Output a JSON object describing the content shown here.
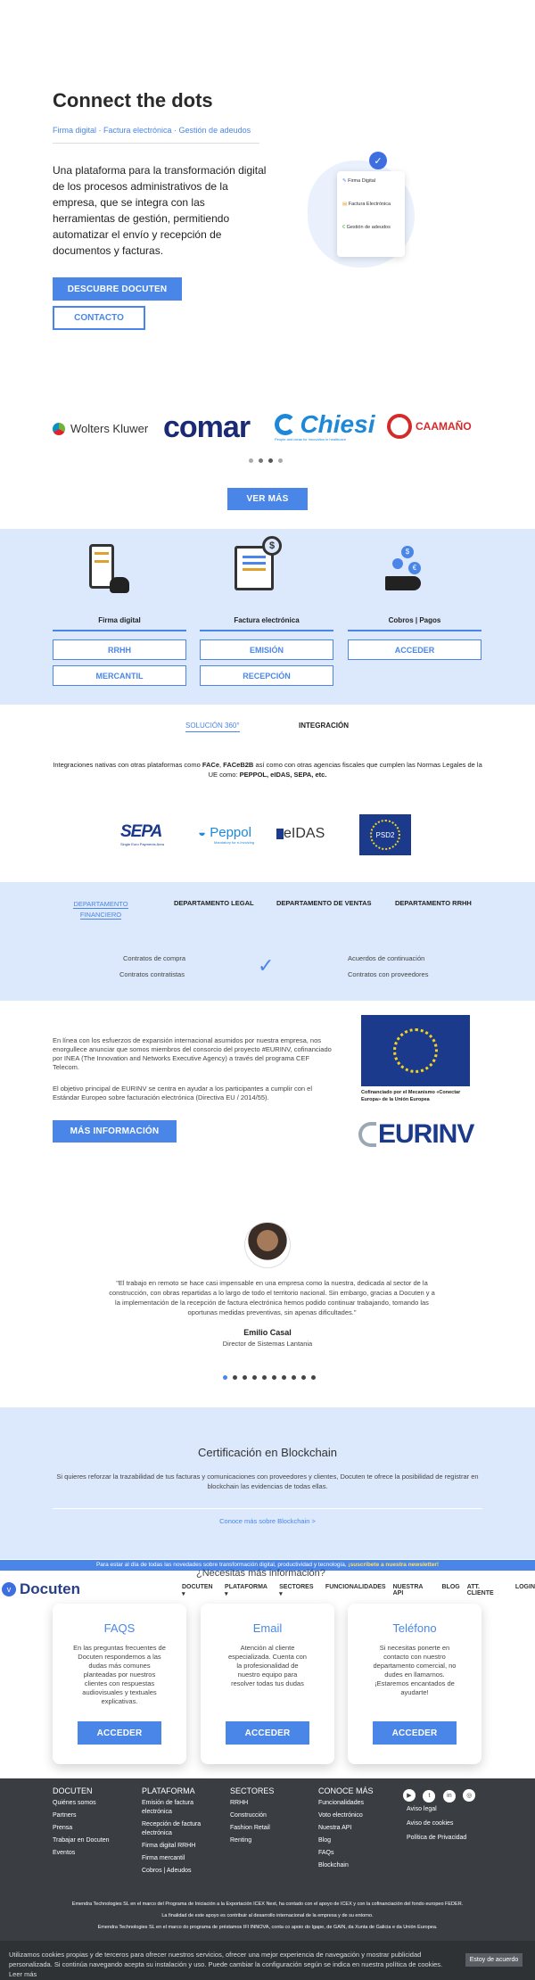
{
  "hero": {
    "title": "Connect the dots",
    "subtitle": "Firma digital · Factura electrónica · Gestión de adeudos",
    "description": "Una plataforma para la transformación digital de los procesos administrativos de la empresa, que se integra con las herramientas de gestión, permitiendo automatizar el envío y recepción de documentos y facturas.",
    "cta_primary": "DESCUBRE DOCUTEN",
    "cta_secondary": "CONTACTO",
    "card_items": [
      "Firma Digital",
      "Factura Electrónica",
      "Gestión de adeudos"
    ]
  },
  "logos": {
    "items": [
      "Wolters Kluwer",
      "comar",
      "Chiesi",
      "CAAMAÑO"
    ],
    "chiesi_tagline": "People and ideas for innovation in healthcare",
    "cta": "VER MÁS"
  },
  "products": {
    "items": [
      {
        "label": "Firma digital"
      },
      {
        "label": "Factura electrónica"
      },
      {
        "label": "Cobros | Pagos"
      }
    ],
    "buttons": [
      "RRHH",
      "EMISIÓN",
      "ACCEDER",
      "MERCANTIL",
      "RECEPCIÓN"
    ]
  },
  "integration": {
    "tabs": [
      "SOLUCIÓN 360°",
      "INTEGRACIÓN"
    ],
    "text_pre": "Integraciones nativas con otras plataformas como ",
    "bold1": "FACe",
    "comma": ", ",
    "bold2": "FACeB2B",
    "text_mid": " así como con otras agencias fiscales que cumplen las Normas Legales de la UE como: ",
    "bold3": "PEPPOL, eIDAS, SEPA, etc.",
    "logos": [
      "SEPA",
      "Single Euro Payments Area",
      "Peppol",
      "Mandatory for e-Invoicing",
      "eIDAS",
      "PSD2"
    ]
  },
  "departments": {
    "tabs": [
      "DEPARTAMENTO FINANCIERO",
      "DEPARTAMENTO LEGAL",
      "DEPARTAMENTO DE VENTAS",
      "DEPARTAMENTO RRHH"
    ],
    "left": [
      "Contratos de compra",
      "Contratos contratistas"
    ],
    "right": [
      "Acuerdos de continuación",
      "Contratos con proveedores"
    ]
  },
  "eu": {
    "p1": "En línea con los esfuerzos de expansión internacional asumidos por nuestra empresa, nos enorgullece anunciar que somos miembros del consorcio del proyecto #EURINV, cofinanciado por INEA (The Innovation and Networks Executive Agency) a través del programa CEF Telecom.",
    "p2": "El objetivo principal de EURINV se centra en ayudar a los participantes a cumplir con el Estándar Europeo sobre facturación electrónica (Directiva EU / 2014/55).",
    "cta": "MÁS INFORMACIÓN",
    "flag_caption": "Cofinanciado por el Mecanismo «Conectar Europa» de la Unión Europea",
    "eurinv": "EURINV"
  },
  "testimonial": {
    "quote": "\"El trabajo en remoto se hace casi impensable en una empresa como la nuestra, dedicada al sector de la construcción, con obras repartidas a lo largo de todo el territorio nacional. Sin embargo, gracias a Docuten y a la implementación de la recepción de factura electrónica hemos podido continuar trabajando, tomando las oportunas medidas preventivas, sin apenas dificultades.\"",
    "name": "Emilio Casal",
    "role": "Director de Sistemas Lantania",
    "dots": 10
  },
  "blockchain": {
    "title": "Certificación en Blockchain",
    "text": "Si quieres reforzar la trazabilidad de tus facturas y comunicaciones con proveedores y clientes, Docuten te ofrece la posibilidad de registrar en blockchain las evidencias de todas ellas.",
    "link": "Conoce más sobre Blockchain >"
  },
  "banner": {
    "text": "Para estar al día de todas las novedades sobre transformación digital, productividad y tecnología, ",
    "link": "¡suscríbete a nuestra newsletter!"
  },
  "nav": {
    "brand": "Docuten",
    "peek": "¿Necesitas más información?",
    "items": [
      "DOCUTEN ▾",
      "PLATAFORMA ▾",
      "SECTORES ▾",
      "FUNCIONALIDADES",
      "NUESTRA API",
      "BLOG",
      "ATT. CLIENTE",
      "LOGIN"
    ]
  },
  "help": {
    "cards": [
      {
        "title": "FAQS",
        "text": "En las preguntas frecuentes de Docuten respondemos a las dudas más comunes planteadas por nuestros clientes con respuestas audiovisuales y textuales explicativas.",
        "btn": "ACCEDER"
      },
      {
        "title": "Email",
        "text": "Atención al cliente especializada. Cuenta con la profesionalidad de nuestro equipo para resolver todas tus dudas",
        "btn": "ACCEDER"
      },
      {
        "title": "Teléfono",
        "text": "Si necesitas ponerte en contacto con nuestro departamento comercial, no dudes en llamarnos. ¡Estaremos encantados de ayudarte!",
        "btn": "ACCEDER"
      }
    ]
  },
  "footer": {
    "cols": [
      {
        "title": "DOCUTEN",
        "items": [
          "Quiénes somos",
          "Partners",
          "Prensa",
          "Trabajar en Docuten",
          "Eventos"
        ]
      },
      {
        "title": "PLATAFORMA",
        "items": [
          "Emisión de factura electrónica",
          "Recepción de factura electrónica",
          "Firma digital RRHH",
          "Firma mercantil",
          "Cobros | Adeudos"
        ]
      },
      {
        "title": "SECTORES",
        "items": [
          "RRHH",
          "Construcción",
          "Fashion Retail",
          "Renting"
        ]
      },
      {
        "title": "CONOCE MÁS",
        "items": [
          "Funcionalidades",
          "Voto electrónico",
          "Nuestra API",
          "Blog",
          "FAQs",
          "Blockchain"
        ]
      }
    ],
    "social": [
      "▶",
      "t",
      "in",
      "◎"
    ],
    "legal": [
      "Aviso legal",
      "Aviso de cookies",
      "Política de Privacidad"
    ],
    "note1": "Emendra Technologies SL en el marco del Programa de Iniciación a la Exportación ICEX Next, ha contado con el apoyo de ICEX y con la cofinanciación del fondo europeo FEDER.",
    "note2": "La finalidad de este apoyo es contribuir al desarrollo internacional de la empresa y de su entorno.",
    "note3": "Emendra Technologies SL en el marco do programa de préstamos IFI INNOVA, conta co apoio do Igape, de GAIN, da Xunta de Galicia e da Unión Europea."
  },
  "cookies": {
    "text": "Utilizamos cookies propias y de terceros para ofrecer nuestros servicios, ofrecer una mejor experiencia de navegación y mostrar publicidad personalizada. Si continúa navegando acepta su instalación y uso. Puede cambiar la configuración según se indica en nuestra política de cookies. Leer más",
    "btn": "Estoy de acuerdo"
  },
  "colors": {
    "accent": "#4a86e8",
    "light": "#dce8fb",
    "dark": "#3a3d42",
    "comar": "#1b2a75",
    "chiesi": "#1e88d8",
    "caamano": "#d42a2a"
  }
}
